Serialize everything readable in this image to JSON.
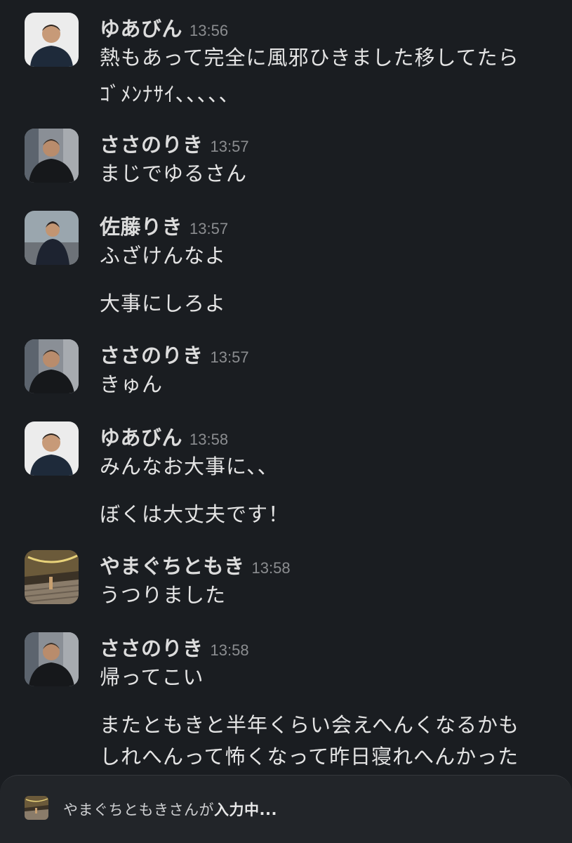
{
  "messages": [
    {
      "user": "ゆあびん",
      "time": "13:56",
      "avatar": "avatar-yuabin",
      "lines": [
        "熱もあって完全に風邪ひきました移してたら",
        "ｺﾞﾒﾝﾅｻｲ、、、、、"
      ]
    },
    {
      "user": "ささのりき",
      "time": "13:57",
      "avatar": "avatar-sasanoriki",
      "lines": [
        "まじでゆるさん"
      ]
    },
    {
      "user": "佐藤りき",
      "time": "13:57",
      "avatar": "avatar-satoriki",
      "lines": [
        "ふざけんなよ",
        "大事にしろよ"
      ]
    },
    {
      "user": "ささのりき",
      "time": "13:57",
      "avatar": "avatar-sasanoriki",
      "lines": [
        "きゅん"
      ]
    },
    {
      "user": "ゆあびん",
      "time": "13:58",
      "avatar": "avatar-yuabin",
      "lines": [
        "みんなお大事に、、",
        "ぼくは大丈夫です！"
      ]
    },
    {
      "user": "やまぐちともき",
      "time": "13:58",
      "avatar": "avatar-yamaguchi",
      "lines": [
        "うつりました"
      ]
    },
    {
      "user": "ささのりき",
      "time": "13:58",
      "avatar": "avatar-sasanoriki",
      "lines": [
        "帰ってこい",
        "またともきと半年くらい会えへんくなるかも",
        "しれへんって怖くなって昨日寝れへんかった"
      ]
    }
  ],
  "typing": {
    "user": "やまぐちともき",
    "prefix": "やまぐちともきさんが",
    "status": "入力中..."
  },
  "colors": {
    "background": "#1a1d21",
    "composer": "#222529",
    "name": "#dcdcdc",
    "timestamp": "#8b8d90",
    "text": "#e4e4e4"
  }
}
